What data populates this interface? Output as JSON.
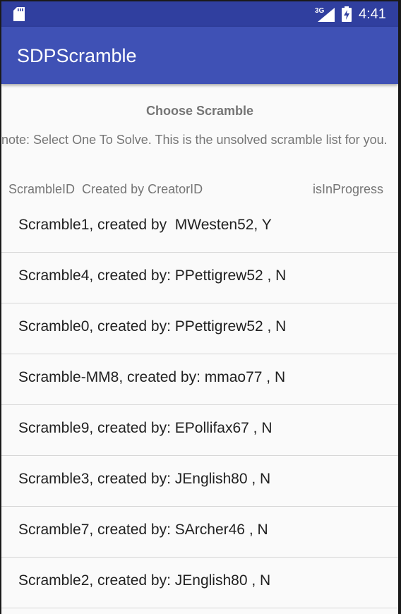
{
  "status_bar": {
    "network_type": "3G",
    "time": "4:41",
    "icons": [
      "sd-card-icon",
      "signal-icon",
      "battery-icon"
    ]
  },
  "app_bar": {
    "title": "SDPScramble"
  },
  "page": {
    "title": "Choose Scramble",
    "note": "note: Select One To Solve. This is the unsolved scramble list for you.",
    "column_headers": {
      "id_and_creator": "ScrambleID  Created by CreatorID",
      "progress": "isInProgress"
    }
  },
  "scramble_list": [
    {
      "text": "Scramble1, created by  MWesten52, Y"
    },
    {
      "text": "Scramble4, created by: PPettigrew52 , N"
    },
    {
      "text": "Scramble0, created by: PPettigrew52 , N"
    },
    {
      "text": "Scramble-MM8, created by: mmao77 , N"
    },
    {
      "text": "Scramble9, created by: EPollifax67 , N"
    },
    {
      "text": "Scramble3, created by: JEnglish80 , N"
    },
    {
      "text": "Scramble7, created by: SArcher46 , N"
    },
    {
      "text": "Scramble2, created by: JEnglish80 , N"
    }
  ],
  "colors": {
    "status_bar": "#303f9f",
    "app_bar": "#3f51b5",
    "background": "#fafafa",
    "secondary_text": "#757575",
    "primary_text": "#212121"
  }
}
